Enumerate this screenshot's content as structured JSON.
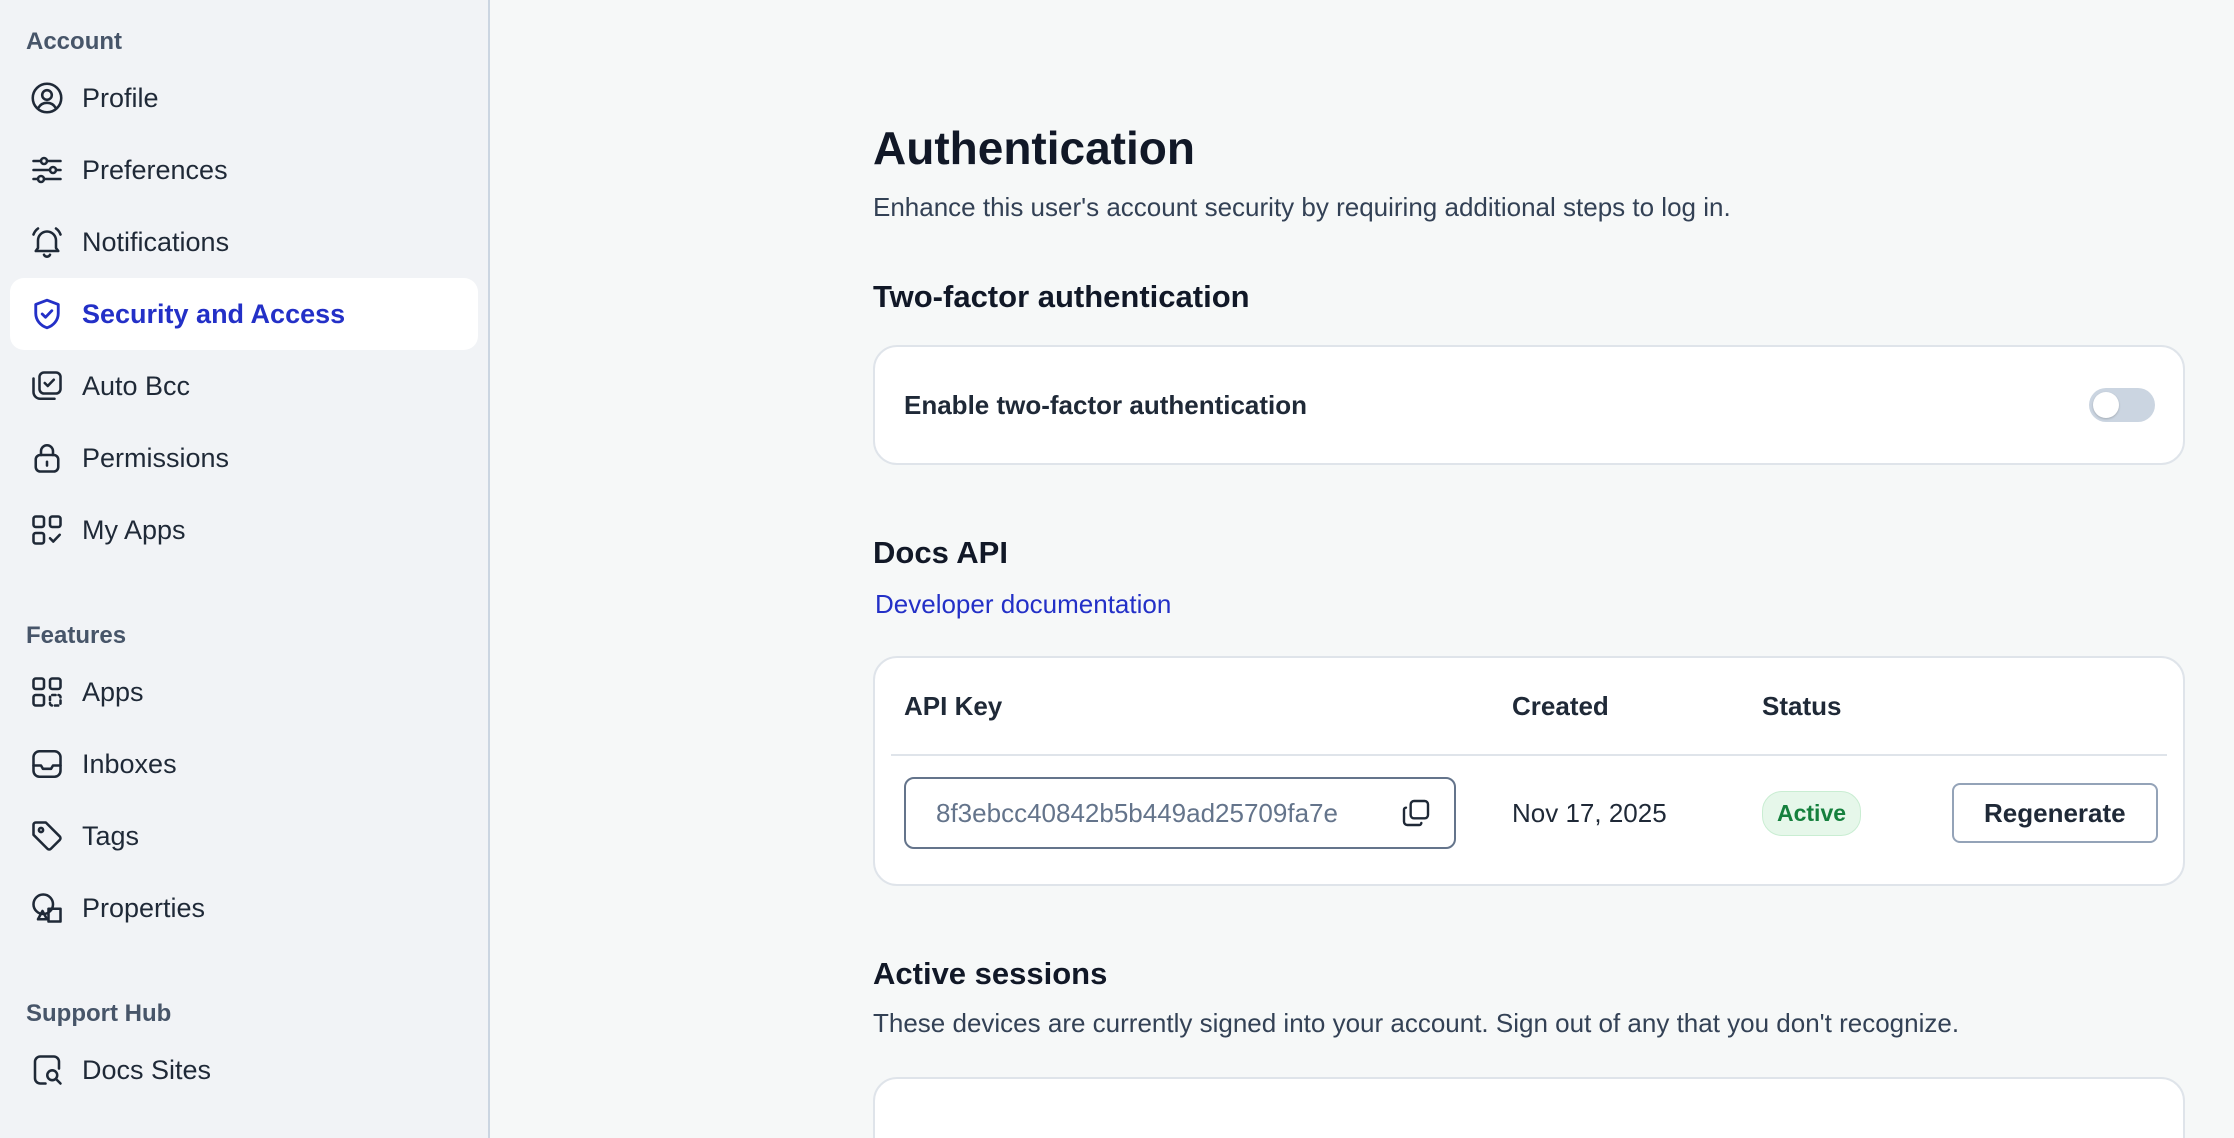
{
  "sidebar": {
    "sections": [
      {
        "title": "Account",
        "items": [
          {
            "label": "Profile",
            "icon": "user-circle-icon"
          },
          {
            "label": "Preferences",
            "icon": "sliders-icon"
          },
          {
            "label": "Notifications",
            "icon": "bell-icon"
          },
          {
            "label": "Security and Access",
            "icon": "shield-check-icon",
            "active": true
          },
          {
            "label": "Auto Bcc",
            "icon": "copy-check-icon"
          },
          {
            "label": "Permissions",
            "icon": "lock-icon"
          },
          {
            "label": "My Apps",
            "icon": "apps-check-icon"
          }
        ]
      },
      {
        "title": "Features",
        "items": [
          {
            "label": "Apps",
            "icon": "apps-grid-icon"
          },
          {
            "label": "Inboxes",
            "icon": "inbox-icon"
          },
          {
            "label": "Tags",
            "icon": "tag-icon"
          },
          {
            "label": "Properties",
            "icon": "shapes-icon"
          }
        ]
      },
      {
        "title": "Support Hub",
        "items": [
          {
            "label": "Docs Sites",
            "icon": "doc-search-icon"
          }
        ]
      }
    ]
  },
  "main": {
    "title": "Authentication",
    "subtitle": "Enhance this user's account security by requiring additional steps to log in.",
    "twofa": {
      "heading": "Two-factor authentication",
      "label": "Enable two-factor authentication",
      "enabled": false
    },
    "docs_api": {
      "heading": "Docs API",
      "link": "Developer documentation",
      "columns": {
        "key": "API Key",
        "created": "Created",
        "status": "Status"
      },
      "row": {
        "key": "8f3ebcc40842b5b449ad25709fa7e",
        "created": "Nov 17, 2025",
        "status": "Active",
        "action": "Regenerate"
      }
    },
    "sessions": {
      "heading": "Active sessions",
      "description": "These devices are currently signed into your account. Sign out of any that you don't recognize."
    }
  },
  "colors": {
    "accent": "#2330c7",
    "active_badge_bg": "#e6f7ea",
    "active_badge_text": "#15803d",
    "sidebar_bg": "#f1f3f6",
    "page_bg": "#f6f8f8"
  }
}
